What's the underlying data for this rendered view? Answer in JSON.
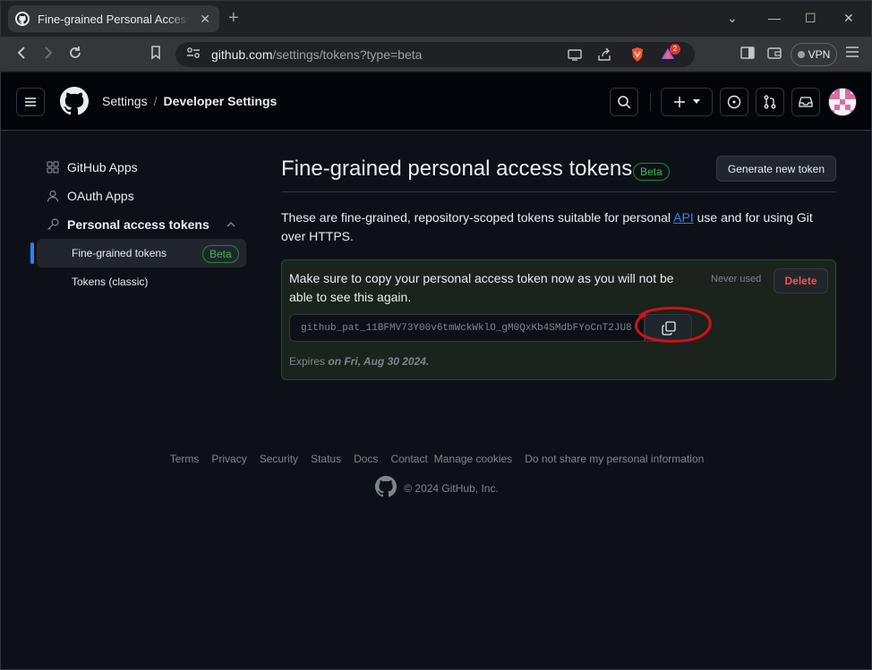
{
  "browser": {
    "tab_title": "Fine-grained Personal Access Tokens",
    "url_host": "github.com",
    "url_path": "/settings/tokens?type=beta",
    "vpn_label": "VPN",
    "notification_count": "2"
  },
  "header": {
    "crumb_settings": "Settings",
    "crumb_separator": "/",
    "crumb_developer": "Developer Settings"
  },
  "sidebar": {
    "github_apps": "GitHub Apps",
    "oauth_apps": "OAuth Apps",
    "personal_tokens": "Personal access tokens",
    "fine_grained": "Fine-grained tokens",
    "fine_grained_badge": "Beta",
    "classic": "Tokens (classic)"
  },
  "main": {
    "title": "Fine-grained personal access tokens",
    "title_badge": "Beta",
    "generate_button": "Generate new token",
    "desc_before": "These are fine-grained, repository-scoped tokens suitable for personal ",
    "desc_link": "API",
    "desc_after": " use and for using Git over HTTPS.",
    "token_message": "Make sure to copy your personal access token now as you will not be able to see this again.",
    "never_used": "Never used",
    "delete_button": "Delete",
    "token_value": "github_pat_11BFMV73Y00v6tmWckWklO_gM0QxKb4SMdbFYoCnT2JU8",
    "expires_label": "Expires",
    "expires_date": "on Fri, Aug 30 2024."
  },
  "footer": {
    "links": [
      "Terms",
      "Privacy",
      "Security",
      "Status",
      "Docs",
      "Contact",
      "Manage cookies",
      "Do not share my personal information"
    ],
    "copyright": "© 2024 GitHub, Inc."
  },
  "colors": {
    "accent": "#2f81f7",
    "success": "#3fb950",
    "danger": "#f85149",
    "annotation": "#d0101a"
  }
}
